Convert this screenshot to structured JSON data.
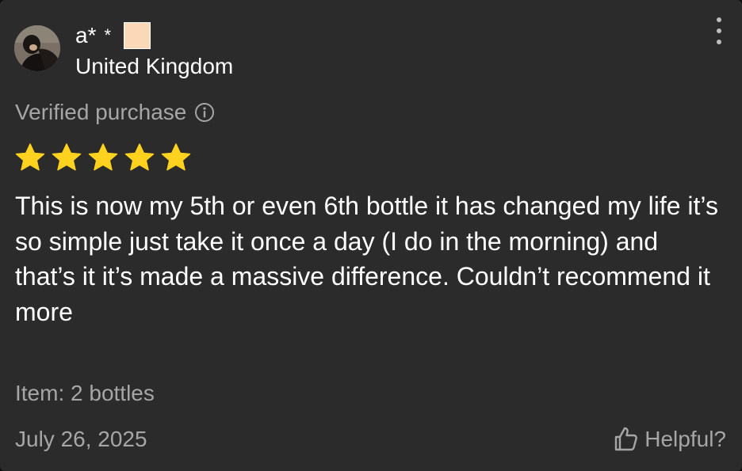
{
  "reviewer": {
    "name": "a*",
    "name_suffix": "*",
    "country": "United Kingdom",
    "flag_color": "#fad9b8"
  },
  "review": {
    "verified_label": "Verified purchase",
    "rating": 5,
    "rating_max": 5,
    "star_color": "#ffd21f",
    "text": "This is now my 5th or even 6th bottle it has changed my life it’s so simple just take it once a day (I do in the morning) and that’s it it’s made a massive difference. Couldn’t recommend it more",
    "item_label": "Item: 2 bottles",
    "date": "July 26, 2025"
  },
  "actions": {
    "helpful_label": "Helpful?",
    "menu_icon": "more-vertical-icon",
    "helpful_icon": "thumbs-up-icon",
    "info_icon": "info-icon"
  },
  "theme": {
    "background": "#2b2b2b",
    "primary_text": "#ffffff",
    "secondary_text": "#a6a6a6"
  }
}
